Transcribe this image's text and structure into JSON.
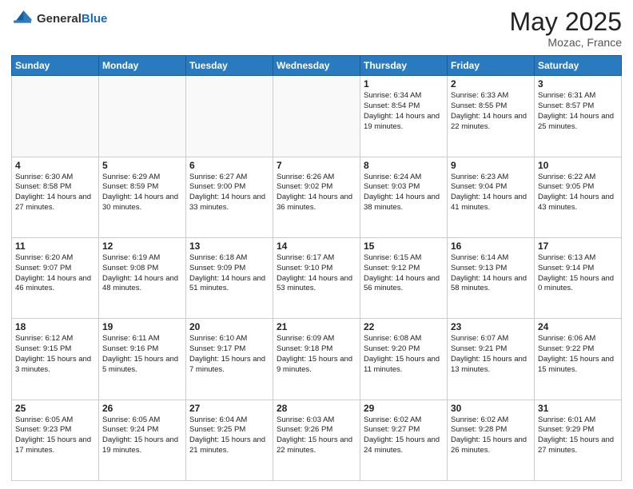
{
  "logo": {
    "general": "General",
    "blue": "Blue"
  },
  "title": "May 2025",
  "location": "Mozac, France",
  "header_days": [
    "Sunday",
    "Monday",
    "Tuesday",
    "Wednesday",
    "Thursday",
    "Friday",
    "Saturday"
  ],
  "weeks": [
    [
      {
        "day": "",
        "info": ""
      },
      {
        "day": "",
        "info": ""
      },
      {
        "day": "",
        "info": ""
      },
      {
        "day": "",
        "info": ""
      },
      {
        "day": "1",
        "info": "Sunrise: 6:34 AM\nSunset: 8:54 PM\nDaylight: 14 hours\nand 19 minutes."
      },
      {
        "day": "2",
        "info": "Sunrise: 6:33 AM\nSunset: 8:55 PM\nDaylight: 14 hours\nand 22 minutes."
      },
      {
        "day": "3",
        "info": "Sunrise: 6:31 AM\nSunset: 8:57 PM\nDaylight: 14 hours\nand 25 minutes."
      }
    ],
    [
      {
        "day": "4",
        "info": "Sunrise: 6:30 AM\nSunset: 8:58 PM\nDaylight: 14 hours\nand 27 minutes."
      },
      {
        "day": "5",
        "info": "Sunrise: 6:29 AM\nSunset: 8:59 PM\nDaylight: 14 hours\nand 30 minutes."
      },
      {
        "day": "6",
        "info": "Sunrise: 6:27 AM\nSunset: 9:00 PM\nDaylight: 14 hours\nand 33 minutes."
      },
      {
        "day": "7",
        "info": "Sunrise: 6:26 AM\nSunset: 9:02 PM\nDaylight: 14 hours\nand 36 minutes."
      },
      {
        "day": "8",
        "info": "Sunrise: 6:24 AM\nSunset: 9:03 PM\nDaylight: 14 hours\nand 38 minutes."
      },
      {
        "day": "9",
        "info": "Sunrise: 6:23 AM\nSunset: 9:04 PM\nDaylight: 14 hours\nand 41 minutes."
      },
      {
        "day": "10",
        "info": "Sunrise: 6:22 AM\nSunset: 9:05 PM\nDaylight: 14 hours\nand 43 minutes."
      }
    ],
    [
      {
        "day": "11",
        "info": "Sunrise: 6:20 AM\nSunset: 9:07 PM\nDaylight: 14 hours\nand 46 minutes."
      },
      {
        "day": "12",
        "info": "Sunrise: 6:19 AM\nSunset: 9:08 PM\nDaylight: 14 hours\nand 48 minutes."
      },
      {
        "day": "13",
        "info": "Sunrise: 6:18 AM\nSunset: 9:09 PM\nDaylight: 14 hours\nand 51 minutes."
      },
      {
        "day": "14",
        "info": "Sunrise: 6:17 AM\nSunset: 9:10 PM\nDaylight: 14 hours\nand 53 minutes."
      },
      {
        "day": "15",
        "info": "Sunrise: 6:15 AM\nSunset: 9:12 PM\nDaylight: 14 hours\nand 56 minutes."
      },
      {
        "day": "16",
        "info": "Sunrise: 6:14 AM\nSunset: 9:13 PM\nDaylight: 14 hours\nand 58 minutes."
      },
      {
        "day": "17",
        "info": "Sunrise: 6:13 AM\nSunset: 9:14 PM\nDaylight: 15 hours\nand 0 minutes."
      }
    ],
    [
      {
        "day": "18",
        "info": "Sunrise: 6:12 AM\nSunset: 9:15 PM\nDaylight: 15 hours\nand 3 minutes."
      },
      {
        "day": "19",
        "info": "Sunrise: 6:11 AM\nSunset: 9:16 PM\nDaylight: 15 hours\nand 5 minutes."
      },
      {
        "day": "20",
        "info": "Sunrise: 6:10 AM\nSunset: 9:17 PM\nDaylight: 15 hours\nand 7 minutes."
      },
      {
        "day": "21",
        "info": "Sunrise: 6:09 AM\nSunset: 9:18 PM\nDaylight: 15 hours\nand 9 minutes."
      },
      {
        "day": "22",
        "info": "Sunrise: 6:08 AM\nSunset: 9:20 PM\nDaylight: 15 hours\nand 11 minutes."
      },
      {
        "day": "23",
        "info": "Sunrise: 6:07 AM\nSunset: 9:21 PM\nDaylight: 15 hours\nand 13 minutes."
      },
      {
        "day": "24",
        "info": "Sunrise: 6:06 AM\nSunset: 9:22 PM\nDaylight: 15 hours\nand 15 minutes."
      }
    ],
    [
      {
        "day": "25",
        "info": "Sunrise: 6:05 AM\nSunset: 9:23 PM\nDaylight: 15 hours\nand 17 minutes."
      },
      {
        "day": "26",
        "info": "Sunrise: 6:05 AM\nSunset: 9:24 PM\nDaylight: 15 hours\nand 19 minutes."
      },
      {
        "day": "27",
        "info": "Sunrise: 6:04 AM\nSunset: 9:25 PM\nDaylight: 15 hours\nand 21 minutes."
      },
      {
        "day": "28",
        "info": "Sunrise: 6:03 AM\nSunset: 9:26 PM\nDaylight: 15 hours\nand 22 minutes."
      },
      {
        "day": "29",
        "info": "Sunrise: 6:02 AM\nSunset: 9:27 PM\nDaylight: 15 hours\nand 24 minutes."
      },
      {
        "day": "30",
        "info": "Sunrise: 6:02 AM\nSunset: 9:28 PM\nDaylight: 15 hours\nand 26 minutes."
      },
      {
        "day": "31",
        "info": "Sunrise: 6:01 AM\nSunset: 9:29 PM\nDaylight: 15 hours\nand 27 minutes."
      }
    ]
  ]
}
